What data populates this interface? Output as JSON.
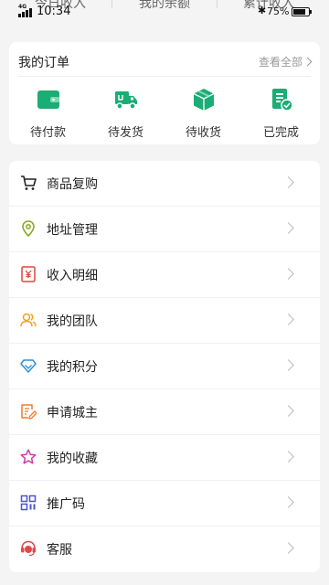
{
  "status_bar": {
    "network": "4G",
    "time": "10:34",
    "bluetooth": "✱",
    "battery": "75%",
    "battery_level": 0.75
  },
  "stats": [
    "今日收入",
    "我的余额",
    "累计收入"
  ],
  "orders": {
    "title": "我的订单",
    "view_all": "查看全部",
    "items": [
      {
        "label": "待付款",
        "icon": "wallet-icon"
      },
      {
        "label": "待发货",
        "icon": "truck-icon"
      },
      {
        "label": "待收货",
        "icon": "box-icon"
      },
      {
        "label": "已完成",
        "icon": "clipboard-check-icon"
      }
    ],
    "accent": "#1aad75"
  },
  "menu": [
    {
      "label": "商品复购",
      "icon": "cart-icon",
      "color": "#222222"
    },
    {
      "label": "地址管理",
      "icon": "location-pin-icon",
      "color": "#8aa822"
    },
    {
      "label": "收入明细",
      "icon": "receipt-yen-icon",
      "color": "#e0473c"
    },
    {
      "label": "我的团队",
      "icon": "team-icon",
      "color": "#f0a21c"
    },
    {
      "label": "我的积分",
      "icon": "diamond-icon",
      "color": "#2e8fd6"
    },
    {
      "label": "申请城主",
      "icon": "edit-document-icon",
      "color": "#ef7b2d"
    },
    {
      "label": "我的收藏",
      "icon": "star-icon",
      "color": "#d63aa6"
    },
    {
      "label": "推广码",
      "icon": "qr-code-icon",
      "color": "#4a55c7"
    },
    {
      "label": "客服",
      "icon": "customer-service-icon",
      "color": "#e04848"
    }
  ]
}
